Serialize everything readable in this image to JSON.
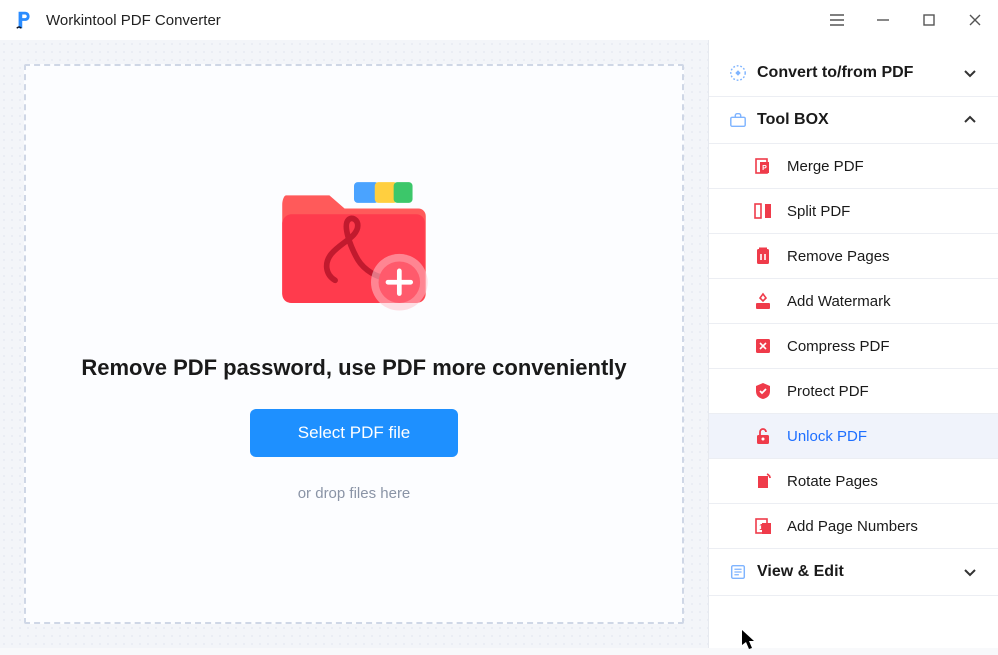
{
  "window": {
    "title": "Workintool PDF Converter"
  },
  "main": {
    "headline": "Remove PDF password, use PDF more conveniently",
    "select_button": "Select PDF file",
    "drop_hint": "or drop files here"
  },
  "sidebar": {
    "sections": {
      "convert": {
        "label": "Convert to/from PDF",
        "expanded": false
      },
      "toolbox": {
        "label": "Tool BOX",
        "expanded": true
      },
      "viewedit": {
        "label": "View & Edit",
        "expanded": false
      }
    },
    "toolbox_items": [
      {
        "label": "Merge PDF",
        "icon": "merge"
      },
      {
        "label": "Split PDF",
        "icon": "split"
      },
      {
        "label": "Remove Pages",
        "icon": "remove"
      },
      {
        "label": "Add Watermark",
        "icon": "watermark"
      },
      {
        "label": "Compress PDF",
        "icon": "compress"
      },
      {
        "label": "Protect PDF",
        "icon": "protect"
      },
      {
        "label": "Unlock PDF",
        "icon": "unlock",
        "active": true
      },
      {
        "label": "Rotate Pages",
        "icon": "rotate"
      },
      {
        "label": "Add Page Numbers",
        "icon": "pagenum"
      }
    ]
  },
  "colors": {
    "accent_blue": "#1e90ff",
    "accent_red": "#ef3b4a",
    "link_blue": "#1e6fff"
  }
}
